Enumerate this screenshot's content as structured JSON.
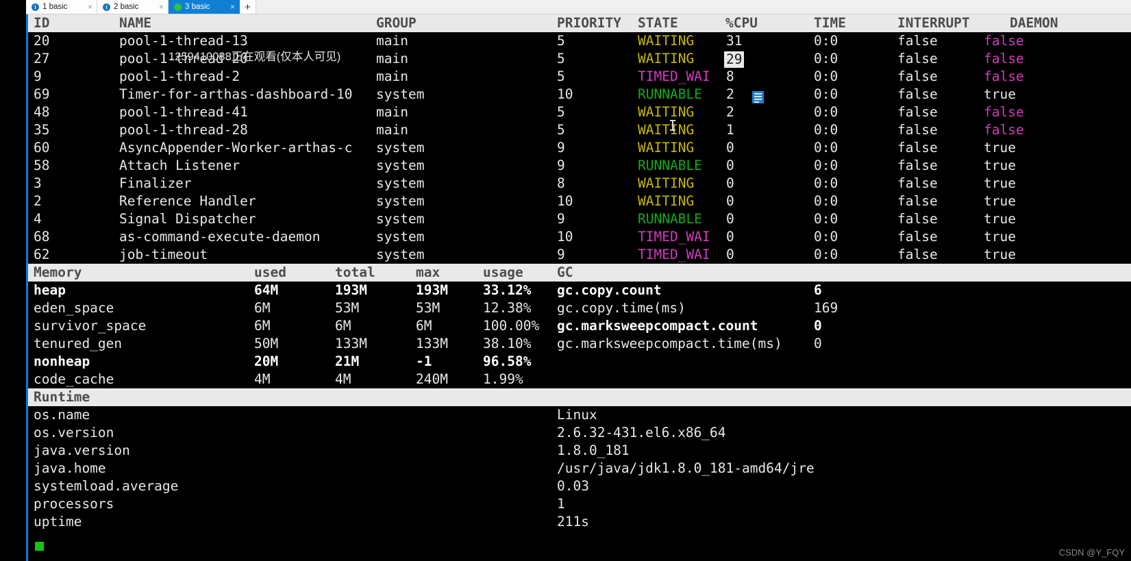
{
  "tabbar": {
    "tabs": [
      {
        "label": "1 basic",
        "close": "×",
        "state": "inactive",
        "icon": "info-circle-icon",
        "badge": "i"
      },
      {
        "label": "2 basic",
        "close": "×",
        "state": "inactive",
        "icon": "info-circle-icon",
        "badge": "i"
      },
      {
        "label": "3 basic",
        "close": "×",
        "state": "active",
        "icon": "status-dot-icon",
        "badge": ""
      }
    ],
    "add_label": "+"
  },
  "threads": {
    "headers": [
      "ID",
      "NAME",
      "GROUP",
      "PRIORITY",
      "STATE",
      "%CPU",
      "TIME",
      "INTERRUPT",
      "DAEMON"
    ],
    "rows": [
      {
        "id": "20",
        "name": "pool-1-thread-13",
        "group": "main",
        "priority": "5",
        "state": "WAITING",
        "state_color": "yellow",
        "cpu": "31",
        "time": "0:0",
        "interrupt": "false",
        "daemon": "false",
        "daemon_color": "magenta",
        "cpu_selected": false
      },
      {
        "id": "27",
        "name": "pool-1-thread-20",
        "group": "main",
        "priority": "5",
        "state": "WAITING",
        "state_color": "yellow",
        "cpu": "29",
        "time": "0:0",
        "interrupt": "false",
        "daemon": "false",
        "daemon_color": "magenta",
        "cpu_selected": true
      },
      {
        "id": "9",
        "name": "pool-1-thread-2",
        "group": "main",
        "priority": "5",
        "state": "TIMED_WAI",
        "state_color": "magenta",
        "cpu": "8",
        "time": "0:0",
        "interrupt": "false",
        "daemon": "false",
        "daemon_color": "magenta",
        "cpu_selected": false
      },
      {
        "id": "69",
        "name": "Timer-for-arthas-dashboard-10",
        "group": "system",
        "priority": "10",
        "state": "RUNNABLE",
        "state_color": "green",
        "cpu": "2",
        "time": "0:0",
        "interrupt": "false",
        "daemon": "true",
        "daemon_color": "white",
        "cpu_selected": false
      },
      {
        "id": "48",
        "name": "pool-1-thread-41",
        "group": "main",
        "priority": "5",
        "state": "WAITING",
        "state_color": "yellow",
        "cpu": "2",
        "time": "0:0",
        "interrupt": "false",
        "daemon": "false",
        "daemon_color": "magenta",
        "cpu_selected": false
      },
      {
        "id": "35",
        "name": "pool-1-thread-28",
        "group": "main",
        "priority": "5",
        "state": "WAITING",
        "state_color": "yellow",
        "cpu": "1",
        "time": "0:0",
        "interrupt": "false",
        "daemon": "false",
        "daemon_color": "magenta",
        "cpu_selected": false
      },
      {
        "id": "60",
        "name": "AsyncAppender-Worker-arthas-c",
        "group": "system",
        "priority": "9",
        "state": "WAITING",
        "state_color": "yellow",
        "cpu": "0",
        "time": "0:0",
        "interrupt": "false",
        "daemon": "true",
        "daemon_color": "white",
        "cpu_selected": false
      },
      {
        "id": "58",
        "name": "Attach Listener",
        "group": "system",
        "priority": "9",
        "state": "RUNNABLE",
        "state_color": "green",
        "cpu": "0",
        "time": "0:0",
        "interrupt": "false",
        "daemon": "true",
        "daemon_color": "white",
        "cpu_selected": false
      },
      {
        "id": "3",
        "name": "Finalizer",
        "group": "system",
        "priority": "8",
        "state": "WAITING",
        "state_color": "yellow",
        "cpu": "0",
        "time": "0:0",
        "interrupt": "false",
        "daemon": "true",
        "daemon_color": "white",
        "cpu_selected": false
      },
      {
        "id": "2",
        "name": "Reference Handler",
        "group": "system",
        "priority": "10",
        "state": "WAITING",
        "state_color": "yellow",
        "cpu": "0",
        "time": "0:0",
        "interrupt": "false",
        "daemon": "true",
        "daemon_color": "white",
        "cpu_selected": false
      },
      {
        "id": "4",
        "name": "Signal Dispatcher",
        "group": "system",
        "priority": "9",
        "state": "RUNNABLE",
        "state_color": "green",
        "cpu": "0",
        "time": "0:0",
        "interrupt": "false",
        "daemon": "true",
        "daemon_color": "white",
        "cpu_selected": false
      },
      {
        "id": "68",
        "name": "as-command-execute-daemon",
        "group": "system",
        "priority": "10",
        "state": "TIMED_WAI",
        "state_color": "magenta",
        "cpu": "0",
        "time": "0:0",
        "interrupt": "false",
        "daemon": "true",
        "daemon_color": "white",
        "cpu_selected": false
      },
      {
        "id": "62",
        "name": "job-timeout",
        "group": "system",
        "priority": "9",
        "state": "TIMED_WAI",
        "state_color": "magenta",
        "cpu": "0",
        "time": "0:0",
        "interrupt": "false",
        "daemon": "true",
        "daemon_color": "white",
        "cpu_selected": false
      }
    ]
  },
  "memory": {
    "headers": [
      "Memory",
      "used",
      "total",
      "max",
      "usage",
      "GC"
    ],
    "rows": [
      {
        "name": "heap",
        "used": "64M",
        "total": "193M",
        "max": "193M",
        "usage": "33.12%",
        "bold": true,
        "gc_key": "gc.copy.count",
        "gc_val": "6",
        "gc_bold": true
      },
      {
        "name": "eden_space",
        "used": "6M",
        "total": "53M",
        "max": "53M",
        "usage": "12.38%",
        "bold": false,
        "gc_key": "gc.copy.time(ms)",
        "gc_val": "169",
        "gc_bold": false
      },
      {
        "name": "survivor_space",
        "used": "6M",
        "total": "6M",
        "max": "6M",
        "usage": "100.00%",
        "bold": false,
        "gc_key": "gc.marksweepcompact.count",
        "gc_val": "0",
        "gc_bold": true
      },
      {
        "name": "tenured_gen",
        "used": "50M",
        "total": "133M",
        "max": "133M",
        "usage": "38.10%",
        "bold": false,
        "gc_key": "gc.marksweepcompact.time(ms)",
        "gc_val": "0",
        "gc_bold": false
      },
      {
        "name": "nonheap",
        "used": "20M",
        "total": "21M",
        "max": "-1",
        "usage": "96.58%",
        "bold": true,
        "gc_key": "",
        "gc_val": "",
        "gc_bold": false
      },
      {
        "name": "code_cache",
        "used": "4M",
        "total": "4M",
        "max": "240M",
        "usage": "1.99%",
        "bold": false,
        "gc_key": "",
        "gc_val": "",
        "gc_bold": false
      }
    ]
  },
  "runtime": {
    "header": "Runtime",
    "rows": [
      {
        "key": "os.name",
        "value": "Linux"
      },
      {
        "key": "os.version",
        "value": "2.6.32-431.el6.x86_64"
      },
      {
        "key": "java.version",
        "value": "1.8.0_181"
      },
      {
        "key": "java.home",
        "value": "/usr/java/jdk1.8.0_181-amd64/jre"
      },
      {
        "key": "systemload.average",
        "value": "0.03"
      },
      {
        "key": "processors",
        "value": "1"
      },
      {
        "key": "uptime",
        "value": "211s"
      }
    ]
  },
  "overlays": {
    "viewer_watermark": "1259410088正在观看(仅本人可见)",
    "csdn_watermark": "CSDN @Y_FQY"
  },
  "colors": {
    "accent": "#1a79c8",
    "tab_active_bg": "#0f7fd4",
    "state_waiting": "#c8b800",
    "state_runnable": "#16a81a",
    "state_timed_wait": "#d43bbf",
    "header_bg": "#e9e9e9",
    "terminal_bg": "#000000",
    "cursor_green": "#17c217"
  }
}
